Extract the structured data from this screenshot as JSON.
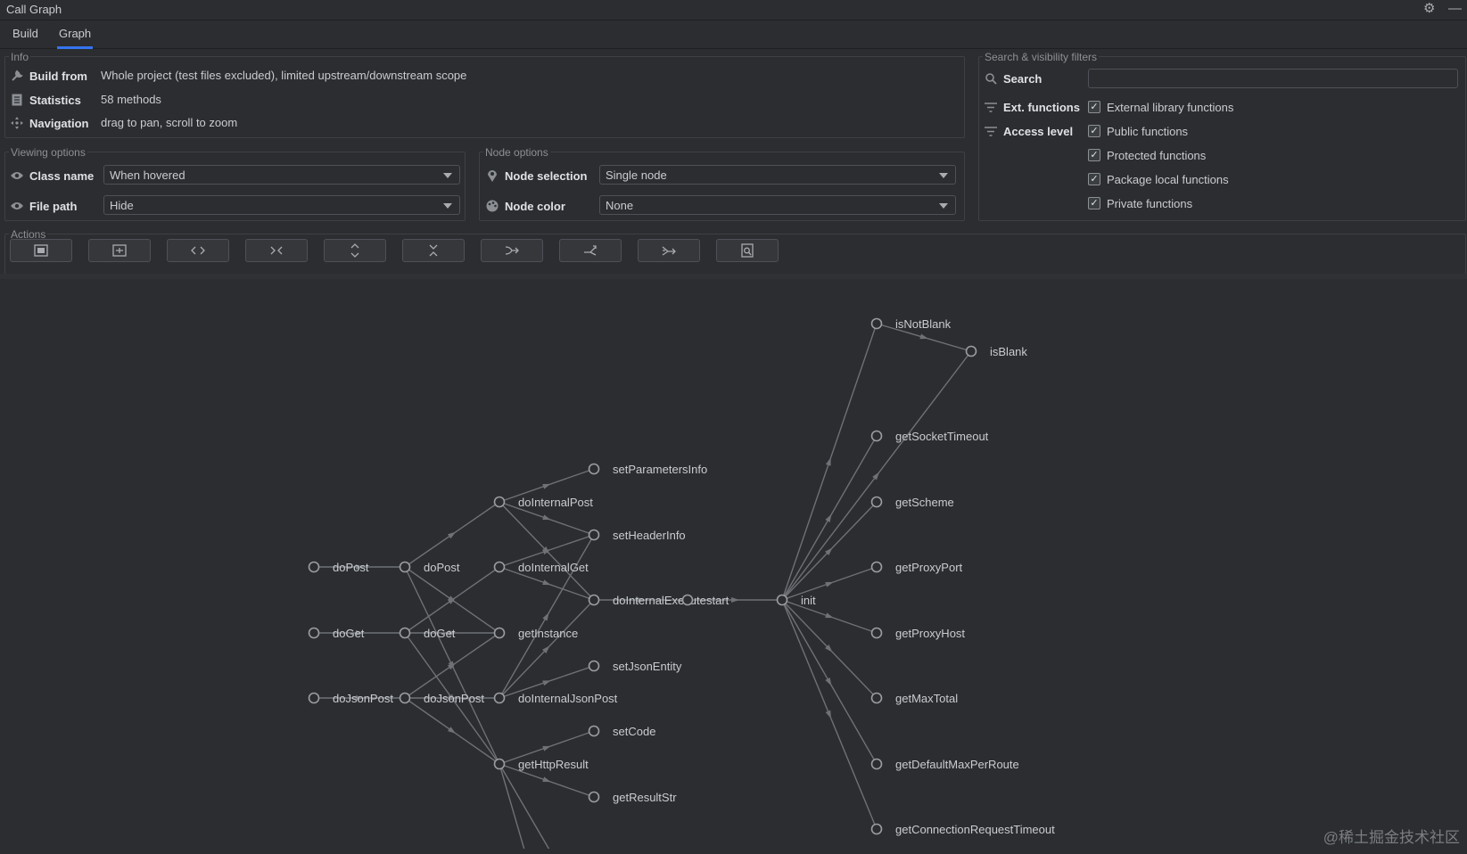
{
  "window": {
    "title": "Call Graph"
  },
  "tabs": [
    {
      "label": "Build",
      "active": false
    },
    {
      "label": "Graph",
      "active": true
    }
  ],
  "info": {
    "title": "Info",
    "rows": [
      {
        "icon": "wrench-icon",
        "label": "Build from",
        "value": "Whole project (test files excluded), limited upstream/downstream scope"
      },
      {
        "icon": "statistics-icon",
        "label": "Statistics",
        "value": "58 methods"
      },
      {
        "icon": "navigation-icon",
        "label": "Navigation",
        "value": "drag to pan, scroll to zoom"
      }
    ]
  },
  "viewing_options": {
    "title": "Viewing options",
    "class_name_label": "Class name",
    "class_name_value": "When hovered",
    "file_path_label": "File path",
    "file_path_value": "Hide"
  },
  "node_options": {
    "title": "Node options",
    "node_selection_label": "Node selection",
    "node_selection_value": "Single node",
    "node_color_label": "Node color",
    "node_color_value": "None"
  },
  "filters": {
    "title": "Search & visibility filters",
    "search_label": "Search",
    "search_value": "",
    "ext_label": "Ext. functions",
    "access_label": "Access level",
    "checkboxes": [
      {
        "label": "External library functions",
        "checked": true
      },
      {
        "label": "Public functions",
        "checked": true
      },
      {
        "label": "Protected functions",
        "checked": true
      },
      {
        "label": "Package local functions",
        "checked": true
      },
      {
        "label": "Private functions",
        "checked": true
      }
    ]
  },
  "actions": {
    "title": "Actions",
    "buttons": [
      "fit-graph-icon",
      "fit-best-icon",
      "expand-horizontal-icon",
      "collapse-horizontal-icon",
      "expand-vertical-icon",
      "collapse-vertical-icon",
      "layout-left-right-icon",
      "layout-upstream-icon",
      "layout-downstream-icon",
      "screenshot-icon"
    ]
  },
  "graph": {
    "nodes": [
      "doPost",
      "doGet",
      "doJsonPost",
      "setParametersInfo",
      "doInternalPost",
      "setHeaderInfo",
      "doInternalGet",
      "getInstance",
      "setJsonEntity",
      "doInternalJsonPost",
      "setCode",
      "getHttpResult",
      "getResultStr",
      "doInternalExecute",
      "start",
      "init",
      "isNotBlank",
      "isBlank",
      "getSocketTimeout",
      "getScheme",
      "getProxyPort",
      "getProxyHost",
      "getMaxTotal",
      "getDefaultMaxPerRoute",
      "getConnectionRequestTimeout"
    ]
  },
  "watermark": "@稀土掘金技术社区",
  "colors": {
    "accent": "#3574f0",
    "background": "#2b2d30"
  }
}
